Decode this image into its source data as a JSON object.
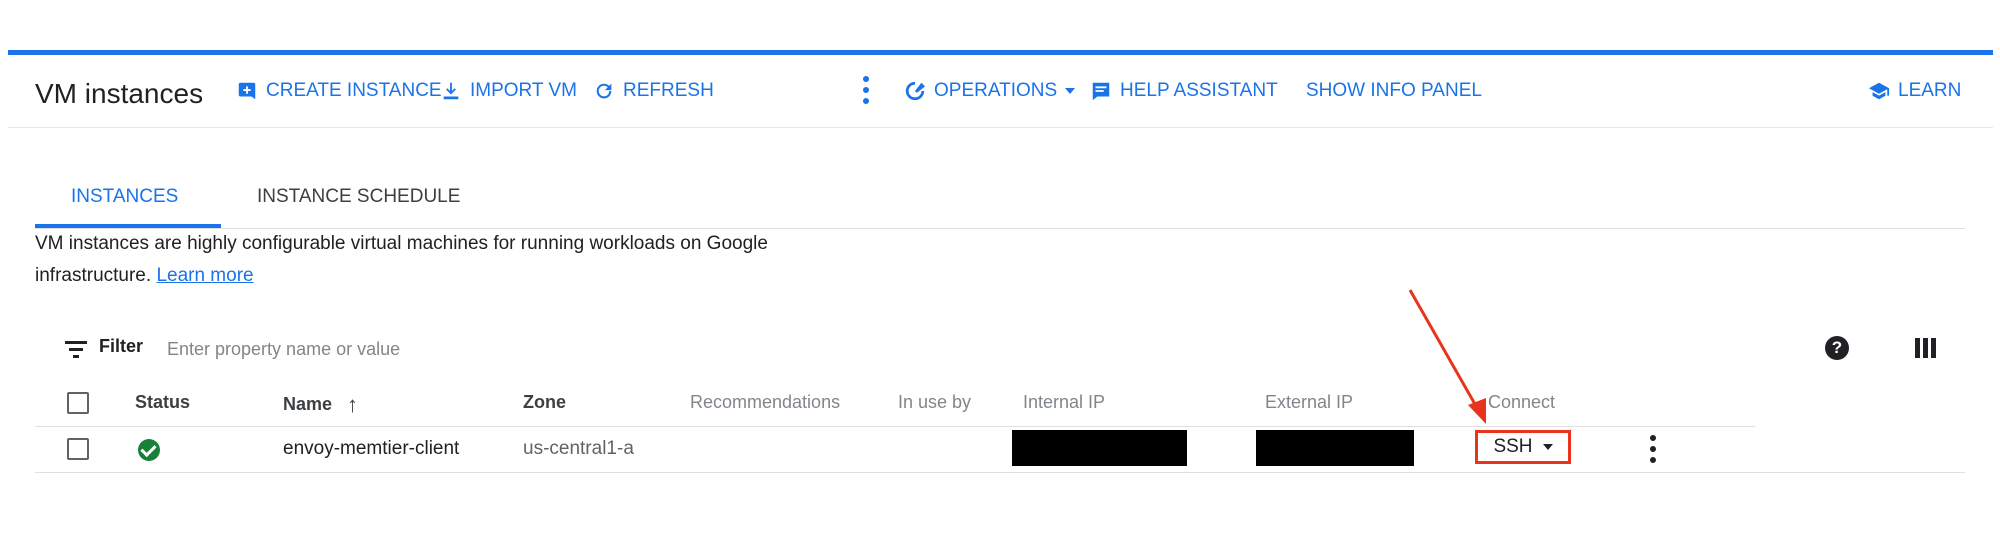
{
  "header": {
    "title": "VM instances",
    "actions": {
      "create": "CREATE INSTANCE",
      "import": "IMPORT VM",
      "refresh": "REFRESH",
      "operations": "OPERATIONS",
      "help_assistant": "HELP ASSISTANT",
      "info_panel": "SHOW INFO PANEL",
      "learn": "LEARN"
    }
  },
  "tabs": [
    {
      "label": "INSTANCES",
      "active": true
    },
    {
      "label": "INSTANCE SCHEDULE",
      "active": false
    }
  ],
  "description": {
    "text": "VM instances are highly configurable virtual machines for running workloads on Google infrastructure.",
    "link": "Learn more"
  },
  "filter": {
    "label": "Filter",
    "placeholder": "Enter property name or value"
  },
  "table": {
    "columns": [
      "Status",
      "Name",
      "Zone",
      "Recommendations",
      "In use by",
      "Internal IP",
      "External IP",
      "Connect"
    ],
    "rows": [
      {
        "status": "running",
        "name": "envoy-memtier-client",
        "zone": "us-central1-a",
        "recommendations": "",
        "in_use_by": "",
        "internal_ip": "",
        "external_ip": "",
        "connect": "SSH"
      }
    ]
  },
  "colors": {
    "accent": "#1a73e8",
    "status_ok": "#188038",
    "highlight": "#e8341c"
  }
}
